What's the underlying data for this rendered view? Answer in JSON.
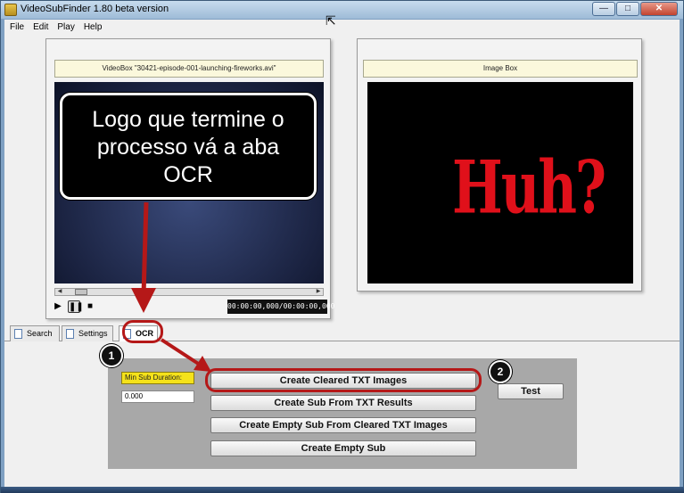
{
  "window": {
    "title": "VideoSubFinder 1.80 beta version"
  },
  "menu": [
    "File",
    "Edit",
    "Play",
    "Help"
  ],
  "video_box": {
    "header": "VideoBox \"30421-episode-001-launching-fireworks.avi\"",
    "timecode": "00:00:00,000/00:00:00,000"
  },
  "image_box": {
    "header": "Image Box",
    "content_text": "Huh?"
  },
  "tabs": [
    {
      "label": "Search"
    },
    {
      "label": "Settings"
    },
    {
      "label": "OCR",
      "active": true
    }
  ],
  "ocr": {
    "min_sub_duration_label": "Min Sub Duration:",
    "min_sub_duration_value": "0.000",
    "buttons": {
      "create_cleared_txt_images": "Create Cleared TXT Images",
      "create_sub_from_txt_results": "Create Sub From TXT Results",
      "create_empty_sub_from_cleared": "Create Empty Sub From Cleared TXT Images",
      "create_empty_sub": "Create Empty Sub",
      "test": "Test"
    }
  },
  "annotation": {
    "callout_line1": "Logo que termine o",
    "callout_line2": "processo vá a aba",
    "callout_line3": "OCR",
    "step1": "1",
    "step2": "2",
    "highlight_color": "#b51818"
  }
}
